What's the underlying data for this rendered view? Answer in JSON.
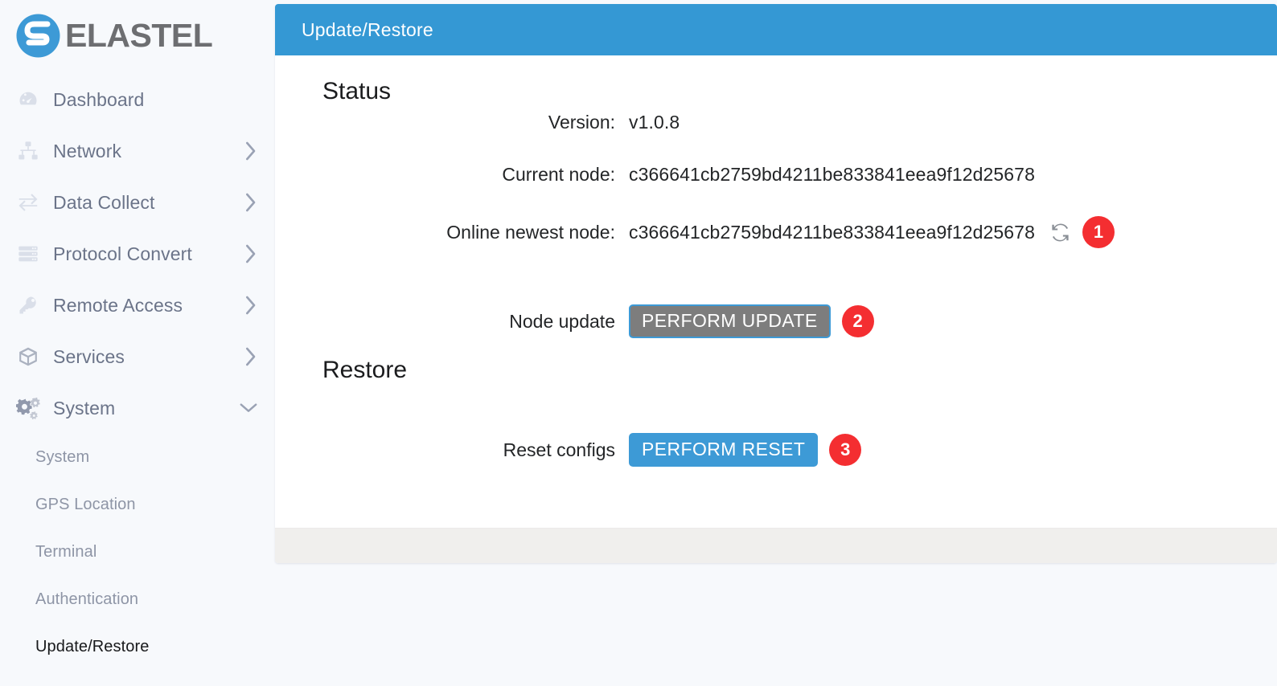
{
  "brand": {
    "name": "ELASTEL",
    "logo_color": "#3d9ad6",
    "text_color": "#6d6e71"
  },
  "sidebar": {
    "items": [
      {
        "label": "Dashboard",
        "icon": "dashboard-icon",
        "chevron": "",
        "expandable": false
      },
      {
        "label": "Network",
        "icon": "network-icon",
        "chevron": "›",
        "expandable": true
      },
      {
        "label": "Data Collect",
        "icon": "data-collect-icon",
        "chevron": "›",
        "expandable": true
      },
      {
        "label": "Protocol Convert",
        "icon": "protocol-convert-icon",
        "chevron": "›",
        "expandable": true
      },
      {
        "label": "Remote Access",
        "icon": "remote-access-icon",
        "chevron": "›",
        "expandable": true
      },
      {
        "label": "Services",
        "icon": "services-icon",
        "chevron": "›",
        "expandable": true
      },
      {
        "label": "System",
        "icon": "system-gear-icon",
        "chevron": "⌄",
        "expandable": true,
        "expanded": true
      }
    ],
    "subitems": [
      {
        "label": "System",
        "active": false
      },
      {
        "label": "GPS Location",
        "active": false
      },
      {
        "label": "Terminal",
        "active": false
      },
      {
        "label": "Authentication",
        "active": false
      },
      {
        "label": "Update/Restore",
        "active": true
      }
    ]
  },
  "card": {
    "header_title": "Update/Restore",
    "header_color": "#3498d4"
  },
  "status": {
    "section_title": "Status",
    "version_label": "Version:",
    "version_value": "v1.0.8",
    "current_node_label": "Current node:",
    "current_node_value": "c366641cb2759bd4211be833841eea9f12d25678",
    "online_node_label": "Online newest node:",
    "online_node_value": "c366641cb2759bd4211be833841eea9f12d25678",
    "refresh_icon": "refresh-sync-icon",
    "refresh_badge": "1",
    "node_update_label": "Node update",
    "node_update_button": "PERFORM UPDATE",
    "node_update_badge": "2"
  },
  "restore": {
    "section_title": "Restore",
    "reset_label": "Reset configs",
    "reset_button": "PERFORM RESET",
    "reset_badge": "3"
  },
  "colors": {
    "accent": "#3498d4",
    "badge_red": "#f42e31",
    "disabled_gray": "#7d7d7d",
    "sidebar_bg": "#f7f9fc",
    "footer_bg": "#f0efed"
  }
}
